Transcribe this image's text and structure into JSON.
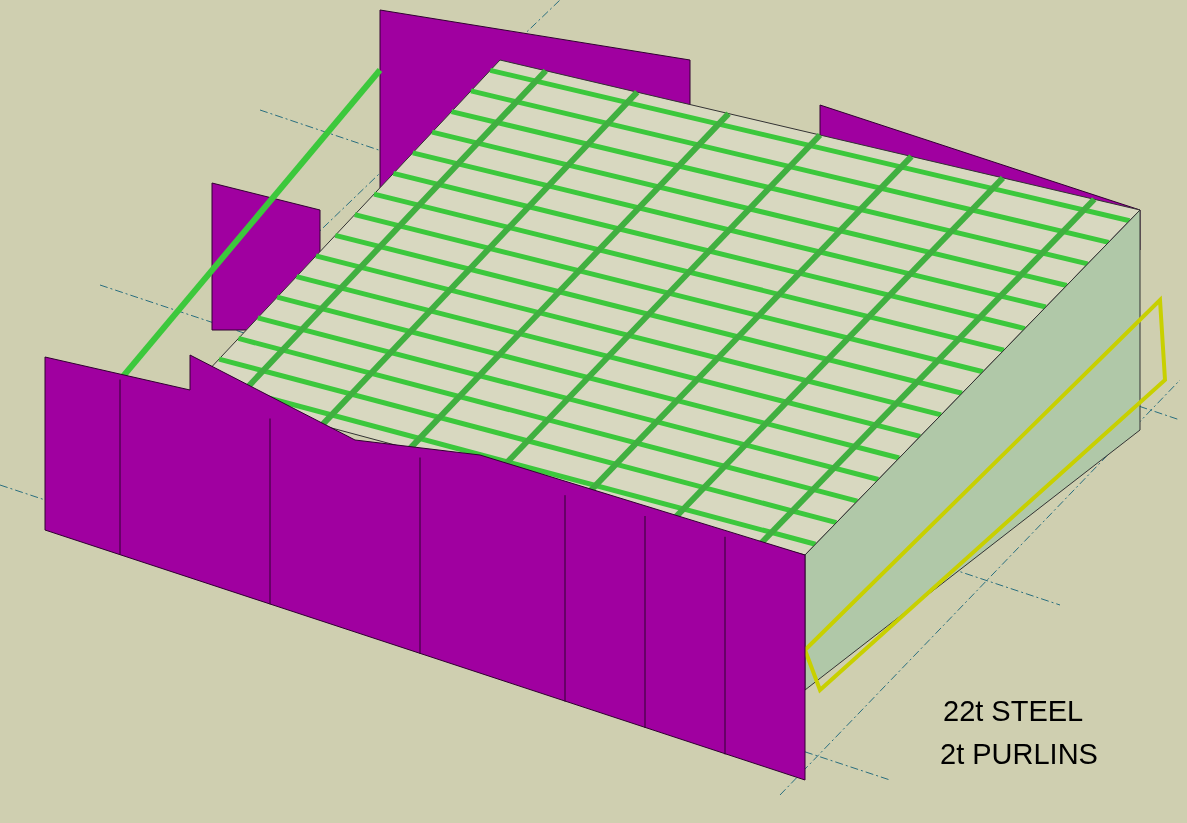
{
  "model_view": {
    "annotations": [
      "22t STEEL",
      "2t PURLINS"
    ]
  }
}
